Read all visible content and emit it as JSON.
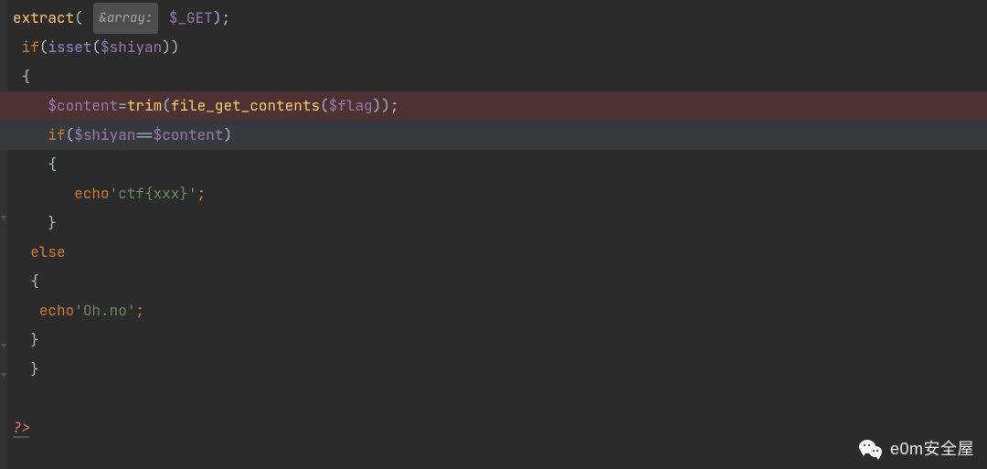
{
  "code": {
    "l1": {
      "fn_extract": "extract",
      "paren_open": "(",
      "hint_text": "&array:",
      "space1": " ",
      "var_get": "$_GET",
      "tail": ");"
    },
    "l2": {
      "indent": " ",
      "kw_if": "if",
      "p_open": "(",
      "fn_isset": "isset",
      "p_open2": "(",
      "var_shiyan": "$shiyan",
      "tail": "))"
    },
    "l3": {
      "indent": " ",
      "brace": "{"
    },
    "l4": {
      "indent": "    ",
      "var_content": "$content",
      "eq": "=",
      "fn_trim": "trim",
      "p_open": "(",
      "fn_fgc": "file_get_contents",
      "p_open2": "(",
      "var_flag": "$flag",
      "tail": "));"
    },
    "l5": {
      "indent": "    ",
      "kw_if": "if",
      "p_open": "(",
      "var_shiyan": "$shiyan",
      "op_eq": "==",
      "var_content": "$content",
      "tail": ")"
    },
    "l6": {
      "indent": "    ",
      "brace": "{"
    },
    "l7": {
      "indent": "       ",
      "kw_echo": "echo",
      "str": "'ctf{xxx}'",
      "semi": ";"
    },
    "l8": {
      "indent": "    ",
      "brace": "}"
    },
    "l9": {
      "indent": "  ",
      "kw_else": "else"
    },
    "l10": {
      "indent": "  ",
      "brace": "{"
    },
    "l11": {
      "indent": "   ",
      "kw_echo": "echo",
      "str": "'Oh.no'",
      "semi": ";"
    },
    "l12": {
      "indent": "  ",
      "brace": "}"
    },
    "l13": {
      "indent": "  ",
      "brace": "}"
    },
    "l14": {
      "close_tag": "?>"
    }
  },
  "watermark": {
    "text": "e0m安全屋"
  }
}
